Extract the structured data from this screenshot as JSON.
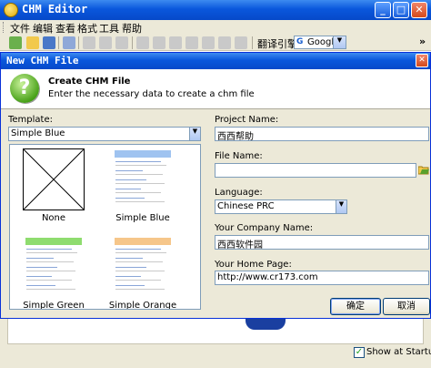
{
  "app": {
    "title": "CHM Editor",
    "minimize_glyph": "_",
    "maximize_glyph": "□",
    "close_glyph": "✕"
  },
  "menu": {
    "items": [
      "文件",
      "编辑",
      "查看",
      "格式",
      "工具",
      "帮助"
    ]
  },
  "toolbar": {
    "translate_label": "翻译引擎",
    "engine": "Google",
    "overflow_glyph": "»"
  },
  "dialog": {
    "title": "New CHM File",
    "close_glyph": "✕",
    "header_title": "Create CHM File",
    "header_subtitle": "Enter the necessary data to create a chm file",
    "help_glyph": "?",
    "template_label": "Template:",
    "template_selected": "Simple Blue",
    "templates": [
      {
        "name": "None"
      },
      {
        "name": "Simple Blue",
        "bar_color": "#9fc3f0"
      },
      {
        "name": "Simple Green",
        "bar_color": "#8fdc6f"
      },
      {
        "name": "Simple Orange",
        "bar_color": "#f6c68a"
      }
    ],
    "project_name_label": "Project Name:",
    "project_name_value": "西西帮助",
    "file_name_label": "File Name:",
    "file_name_value": "",
    "language_label": "Language:",
    "language_value": "Chinese PRC",
    "company_label": "Your Company Name:",
    "company_value": "西西软件园",
    "homepage_label": "Your Home Page:",
    "homepage_value": "http://www.cr173.com",
    "ok_label": "确定",
    "cancel_label": "取消"
  },
  "footer": {
    "show_at_startup_label": "Show at Startup",
    "show_at_startup_checked": true,
    "check_glyph": "✓"
  },
  "colors": {
    "xp_blue": "#0a57dc",
    "dialog_face": "#ece9d8",
    "close_red": "#d44a1c"
  }
}
